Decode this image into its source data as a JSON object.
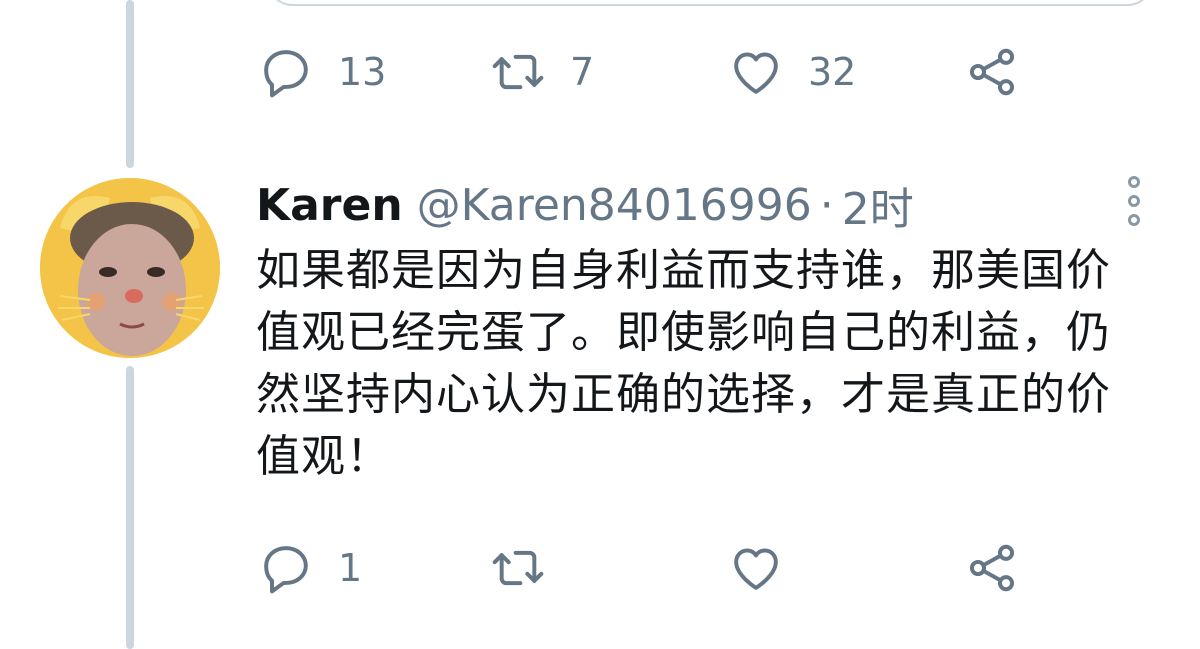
{
  "previous_tweet": {
    "actions": {
      "reply_count": "13",
      "retweet_count": "7",
      "like_count": "32"
    }
  },
  "tweet": {
    "display_name": "Karen",
    "handle": "@Karen84016996",
    "separator": "·",
    "timestamp": "2时",
    "body_lines": [
      "如果都是因为自身利益而支持谁，那美国价",
      "值观已经完蛋了。即使影响自己的利益，仍",
      "然坚持内心认为正确的选择，才是真正的价",
      "值观！"
    ],
    "actions": {
      "reply_count": "1"
    }
  },
  "colors": {
    "text_primary": "#14171a",
    "text_secondary": "#657786",
    "thread_line": "#ccd6dd",
    "avatar_bg": "#f3c447"
  },
  "icons": [
    "reply-icon",
    "retweet-icon",
    "like-icon",
    "share-icon",
    "more-options-icon"
  ]
}
